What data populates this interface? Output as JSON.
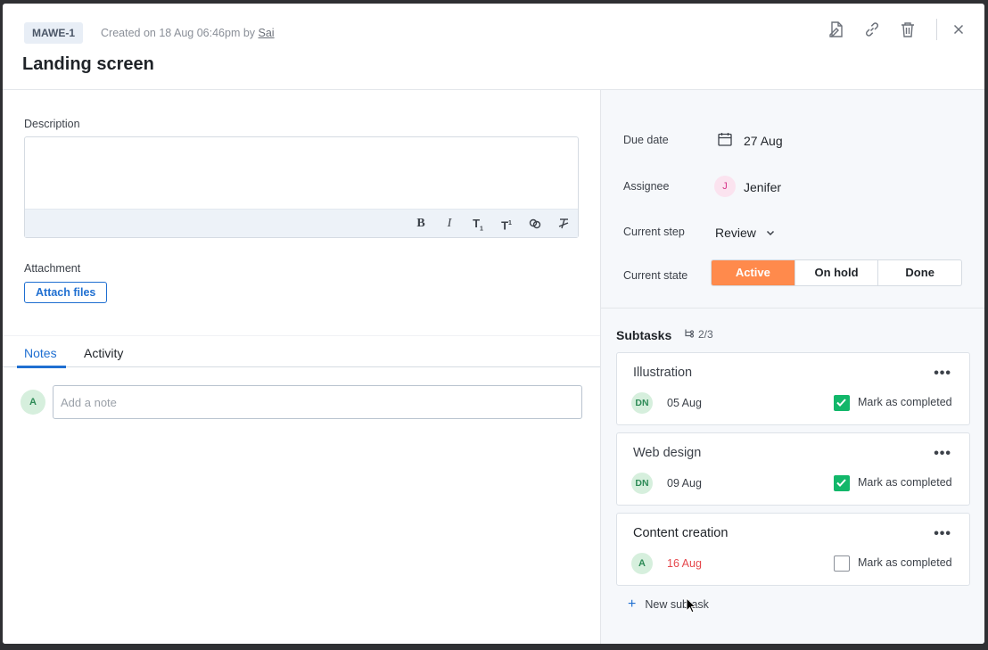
{
  "header": {
    "key": "MAWE-1",
    "created_prefix": "Created on 18 Aug 06:46pm by ",
    "created_by": "Sai",
    "title": "Landing screen"
  },
  "description": {
    "label": "Description"
  },
  "attachment": {
    "label": "Attachment",
    "button": "Attach files"
  },
  "tabs": [
    {
      "label": "Notes",
      "active": true
    },
    {
      "label": "Activity",
      "active": false
    }
  ],
  "note": {
    "avatar": "A",
    "placeholder": "Add a note"
  },
  "details": {
    "due_date_label": "Due date",
    "due_date": "27 Aug",
    "assignee_label": "Assignee",
    "assignee_initial": "J",
    "assignee": "Jenifer",
    "step_label": "Current step",
    "step": "Review",
    "state_label": "Current state",
    "states": [
      "Active",
      "On hold",
      "Done"
    ],
    "active_state": "Active"
  },
  "subtasks": {
    "title": "Subtasks",
    "count": "2/3",
    "items": [
      {
        "title": "Illustration",
        "avatar": "DN",
        "date": "05 Aug",
        "overdue": false,
        "completed": true,
        "complete_label": "Mark as completed"
      },
      {
        "title": "Web design",
        "avatar": "DN",
        "date": "09 Aug",
        "overdue": false,
        "completed": true,
        "complete_label": "Mark as completed"
      },
      {
        "title": "Content creation",
        "avatar": "A",
        "date": "16 Aug",
        "overdue": true,
        "completed": false,
        "complete_label": "Mark as completed"
      }
    ],
    "new_label": "New subtask"
  },
  "colors": {
    "accent": "#1f6fd1",
    "active_state": "#ff8a4c",
    "checked": "#12b76a",
    "overdue": "#e5484d"
  }
}
